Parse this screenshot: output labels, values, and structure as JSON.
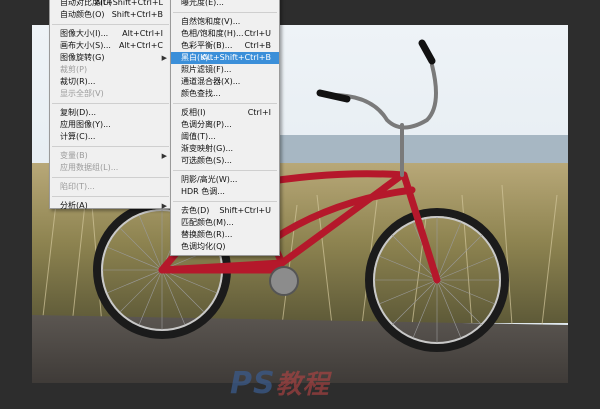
{
  "left_menu": {
    "items": [
      {
        "label": "自动对比度(U)",
        "shortcut": "Alt+Shift+Ctrl+L",
        "disabled": false
      },
      {
        "label": "自动颜色(O)",
        "shortcut": "Shift+Ctrl+B",
        "disabled": false
      },
      {
        "sep": true
      },
      {
        "label": "图像大小(I)...",
        "shortcut": "Alt+Ctrl+I",
        "disabled": false
      },
      {
        "label": "画布大小(S)...",
        "shortcut": "Alt+Ctrl+C",
        "disabled": false
      },
      {
        "label": "图像旋转(G)",
        "shortcut": "",
        "disabled": false,
        "submenu": true
      },
      {
        "label": "裁剪(P)",
        "shortcut": "",
        "disabled": true
      },
      {
        "label": "裁切(R)...",
        "shortcut": "",
        "disabled": false
      },
      {
        "label": "显示全部(V)",
        "shortcut": "",
        "disabled": true
      },
      {
        "sep": true
      },
      {
        "label": "复制(D)...",
        "shortcut": "",
        "disabled": false
      },
      {
        "label": "应用图像(Y)...",
        "shortcut": "",
        "disabled": false
      },
      {
        "label": "计算(C)...",
        "shortcut": "",
        "disabled": false
      },
      {
        "sep": true
      },
      {
        "label": "变量(B)",
        "shortcut": "",
        "disabled": true,
        "submenu": true
      },
      {
        "label": "应用数据组(L)...",
        "shortcut": "",
        "disabled": true
      },
      {
        "sep": true
      },
      {
        "label": "陷印(T)...",
        "shortcut": "",
        "disabled": true
      },
      {
        "sep": true
      },
      {
        "label": "分析(A)",
        "shortcut": "",
        "disabled": false,
        "submenu": true
      }
    ]
  },
  "right_menu": {
    "items": [
      {
        "label": "曝光度(E)...",
        "shortcut": "",
        "disabled": false
      },
      {
        "sep": true
      },
      {
        "label": "自然饱和度(V)...",
        "shortcut": "",
        "disabled": false
      },
      {
        "label": "色相/饱和度(H)...",
        "shortcut": "Ctrl+U",
        "disabled": false
      },
      {
        "label": "色彩平衡(B)...",
        "shortcut": "Ctrl+B",
        "disabled": false
      },
      {
        "label": "黑白(K)...",
        "shortcut": "Alt+Shift+Ctrl+B",
        "disabled": false,
        "highlighted": true
      },
      {
        "label": "照片滤镜(F)...",
        "shortcut": "",
        "disabled": false
      },
      {
        "label": "通道混合器(X)...",
        "shortcut": "",
        "disabled": false
      },
      {
        "label": "颜色查找...",
        "shortcut": "",
        "disabled": false
      },
      {
        "sep": true
      },
      {
        "label": "反相(I)",
        "shortcut": "Ctrl+I",
        "disabled": false
      },
      {
        "label": "色调分离(P)...",
        "shortcut": "",
        "disabled": false
      },
      {
        "label": "阈值(T)...",
        "shortcut": "",
        "disabled": false
      },
      {
        "label": "渐变映射(G)...",
        "shortcut": "",
        "disabled": false
      },
      {
        "label": "可选颜色(S)...",
        "shortcut": "",
        "disabled": false
      },
      {
        "sep": true
      },
      {
        "label": "阴影/高光(W)...",
        "shortcut": "",
        "disabled": false
      },
      {
        "label": "HDR 色调...",
        "shortcut": "",
        "disabled": false
      },
      {
        "sep": true
      },
      {
        "label": "去色(D)",
        "shortcut": "Shift+Ctrl+U",
        "disabled": false
      },
      {
        "label": "匹配颜色(M)...",
        "shortcut": "",
        "disabled": false
      },
      {
        "label": "替换颜色(R)...",
        "shortcut": "",
        "disabled": false
      },
      {
        "label": "色调均化(Q)",
        "shortcut": "",
        "disabled": false
      }
    ]
  },
  "watermark": {
    "ps": "PS",
    "cn": "教程"
  },
  "colors": {
    "highlight": "#3b8fd9",
    "bike": "#b5182b",
    "app_bg": "#2d2d2d"
  }
}
